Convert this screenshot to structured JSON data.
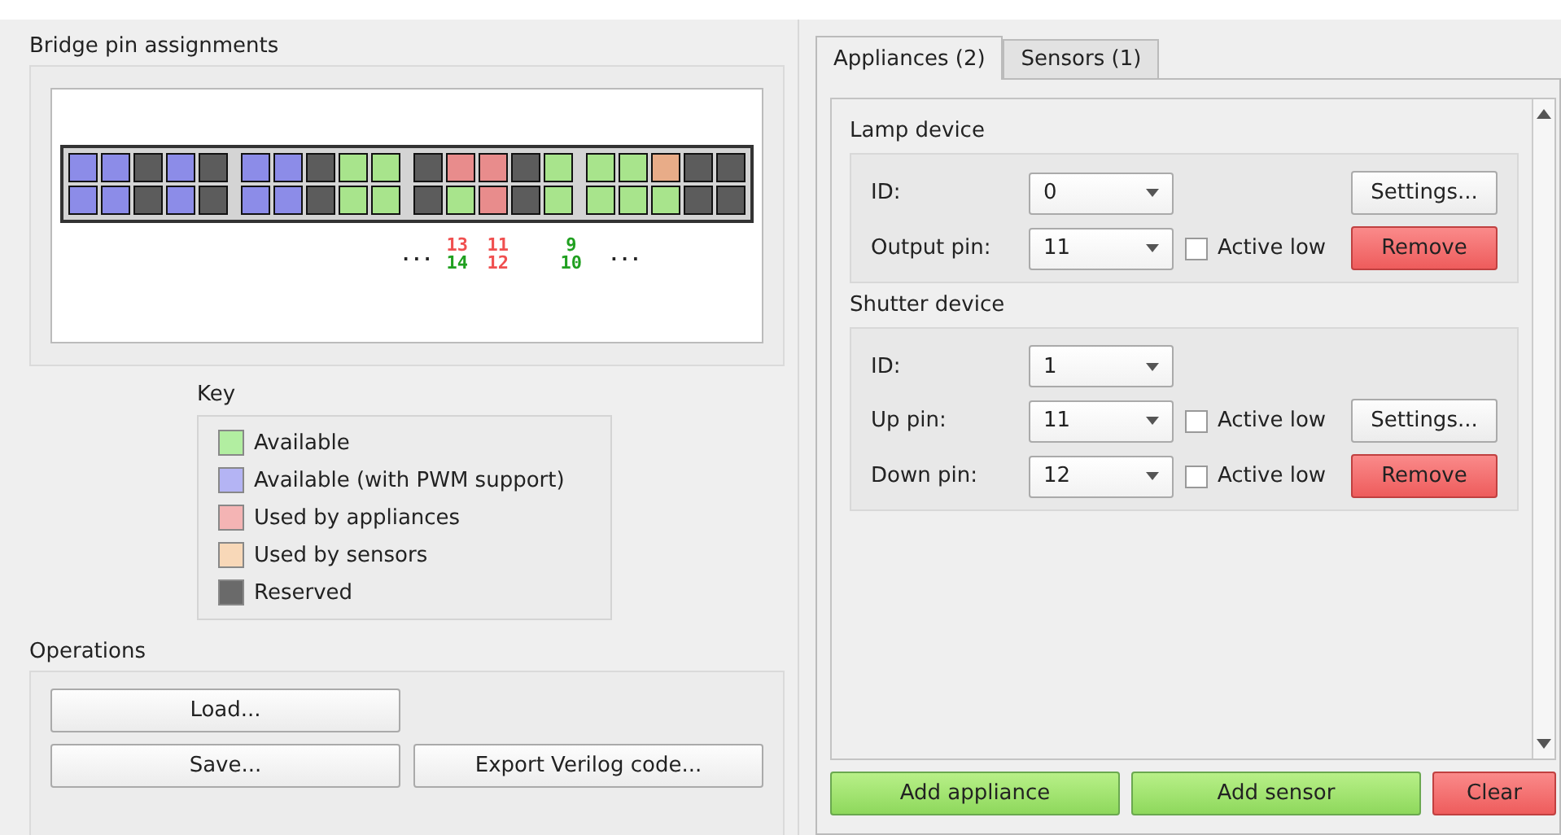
{
  "pin_panel": {
    "title": "Bridge pin assignments",
    "pin_rows": [
      [
        {
          "color": "#8c8ce8"
        },
        {
          "color": "#8c8ce8"
        },
        {
          "color": "#5c5c5c"
        },
        {
          "color": "#8c8ce8"
        },
        {
          "color": "#5c5c5c"
        },
        {
          "color": "#8c8ce8"
        },
        {
          "color": "#8c8ce8"
        },
        {
          "color": "#5c5c5c"
        },
        {
          "color": "#a8e48c"
        },
        {
          "color": "#a8e48c"
        },
        {
          "color": "#5c5c5c"
        },
        {
          "color": "#e88c8c"
        },
        {
          "color": "#e88c8c"
        },
        {
          "color": "#5c5c5c"
        },
        {
          "color": "#a8e48c"
        },
        {
          "color": "#a8e48c"
        },
        {
          "color": "#a8e48c"
        },
        {
          "color": "#e8ac88"
        },
        {
          "color": "#5c5c5c"
        },
        {
          "color": "#5c5c5c"
        }
      ],
      [
        {
          "color": "#8c8ce8"
        },
        {
          "color": "#8c8ce8"
        },
        {
          "color": "#5c5c5c"
        },
        {
          "color": "#8c8ce8"
        },
        {
          "color": "#5c5c5c"
        },
        {
          "color": "#8c8ce8"
        },
        {
          "color": "#8c8ce8"
        },
        {
          "color": "#5c5c5c"
        },
        {
          "color": "#a8e48c"
        },
        {
          "color": "#a8e48c"
        },
        {
          "color": "#5c5c5c"
        },
        {
          "color": "#a8e48c"
        },
        {
          "color": "#e88c8c"
        },
        {
          "color": "#5c5c5c"
        },
        {
          "color": "#a8e48c"
        },
        {
          "color": "#a8e48c"
        },
        {
          "color": "#a8e48c"
        },
        {
          "color": "#a8e48c"
        },
        {
          "color": "#5c5c5c"
        },
        {
          "color": "#5c5c5c"
        }
      ]
    ],
    "ellipsis_left": "...",
    "ellipsis_right": "...",
    "pin_labels": [
      [
        {
          "text": "13",
          "color": "#f05050"
        },
        {
          "text": "14",
          "color": "#20a020"
        }
      ],
      [
        {
          "text": "11",
          "color": "#f05050"
        },
        {
          "text": "12",
          "color": "#f05050"
        }
      ],
      [
        {
          "text": "9",
          "color": "#20a020"
        },
        {
          "text": "10",
          "color": "#20a020"
        }
      ]
    ]
  },
  "key": {
    "title": "Key",
    "items": [
      {
        "label": "Available",
        "color": "#b2eea1"
      },
      {
        "label": "Available (with PWM support)",
        "color": "#b4b4f4"
      },
      {
        "label": "Used by appliances",
        "color": "#f4b4b4"
      },
      {
        "label": "Used by sensors",
        "color": "#f8d8b8"
      },
      {
        "label": "Reserved",
        "color": "#6a6a6a"
      }
    ]
  },
  "operations": {
    "title": "Operations",
    "buttons": [
      "Load...",
      "Save...",
      "Export Verilog code..."
    ]
  },
  "tabs": [
    {
      "label": "Appliances (2)",
      "selected": true
    },
    {
      "label": "Sensors (1)",
      "selected": false
    }
  ],
  "devices": [
    {
      "title": "Lamp device",
      "rows": [
        {
          "label": "ID:",
          "value": "0",
          "active_low": null,
          "button": {
            "label": "Settings...",
            "kind": "settings"
          }
        },
        {
          "label": "Output pin:",
          "value": "11",
          "active_low": {
            "label": "Active low",
            "checked": false
          },
          "button": {
            "label": "Remove",
            "kind": "remove"
          }
        }
      ]
    },
    {
      "title": "Shutter device",
      "rows": [
        {
          "label": "ID:",
          "value": "1",
          "active_low": null,
          "button": null
        },
        {
          "label": "Up pin:",
          "value": "11",
          "active_low": {
            "label": "Active low",
            "checked": false
          },
          "button": {
            "label": "Settings...",
            "kind": "settings"
          }
        },
        {
          "label": "Down pin:",
          "value": "12",
          "active_low": {
            "label": "Active low",
            "checked": false
          },
          "button": {
            "label": "Remove",
            "kind": "remove"
          }
        }
      ]
    }
  ],
  "bottom_buttons": [
    {
      "label": "Add appliance",
      "kind": "add"
    },
    {
      "label": "Add sensor",
      "kind": "add"
    },
    {
      "label": "Clear",
      "kind": "remove"
    }
  ]
}
